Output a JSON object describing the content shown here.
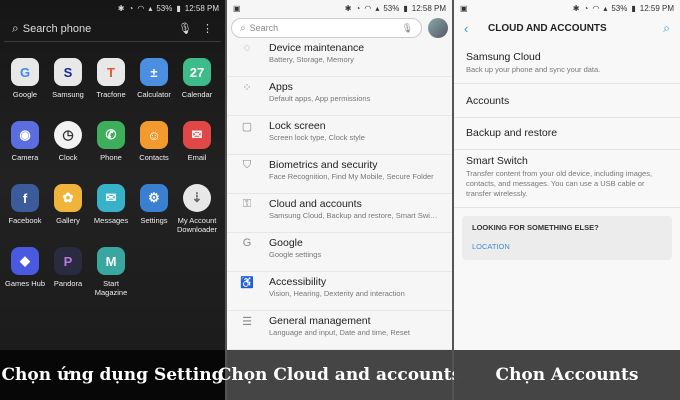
{
  "panel1": {
    "status": {
      "battery": "53%",
      "time": "12:58 PM"
    },
    "search_placeholder": "Search phone",
    "apps": [
      {
        "label": "Google",
        "icon": "google-folder-icon",
        "glyph": "G",
        "color": "#e8e8e8",
        "fg": "#4285f4"
      },
      {
        "label": "Samsung",
        "icon": "samsung-folder-icon",
        "glyph": "S",
        "color": "#e8e8e8",
        "fg": "#1428a0"
      },
      {
        "label": "Tracfone",
        "icon": "tracfone-folder-icon",
        "glyph": "T",
        "color": "#e8e8e8",
        "fg": "#e05a2a"
      },
      {
        "label": "Calculator",
        "icon": "calculator-icon",
        "glyph": "±",
        "color": "#4a8fe0",
        "fg": "#ffffff"
      },
      {
        "label": "Calendar",
        "icon": "calendar-icon",
        "glyph": "27",
        "color": "#3dbb8a",
        "fg": "#ffffff"
      },
      {
        "label": "Camera",
        "icon": "camera-icon",
        "glyph": "◉",
        "color": "#5b6ee0",
        "fg": "#ffffff"
      },
      {
        "label": "Clock",
        "icon": "clock-icon",
        "glyph": "◷",
        "color": "#f2f2f2",
        "fg": "#333333"
      },
      {
        "label": "Phone",
        "icon": "phone-icon",
        "glyph": "✆",
        "color": "#3fae5c",
        "fg": "#ffffff"
      },
      {
        "label": "Contacts",
        "icon": "contacts-icon",
        "glyph": "☺",
        "color": "#f29a2e",
        "fg": "#ffffff"
      },
      {
        "label": "Email",
        "icon": "email-icon",
        "glyph": "✉",
        "color": "#e04848",
        "fg": "#ffffff"
      },
      {
        "label": "Facebook",
        "icon": "facebook-icon",
        "glyph": "f",
        "color": "#3b5b9a",
        "fg": "#ffffff"
      },
      {
        "label": "Gallery",
        "icon": "gallery-icon",
        "glyph": "✿",
        "color": "#f0b43a",
        "fg": "#ffffff"
      },
      {
        "label": "Messages",
        "icon": "messages-icon",
        "glyph": "✉",
        "color": "#38b2c9",
        "fg": "#ffffff"
      },
      {
        "label": "Settings",
        "icon": "settings-icon",
        "glyph": "⚙",
        "color": "#3b7fd0",
        "fg": "#ffffff"
      },
      {
        "label": "My Account Downloader",
        "icon": "my-account-icon",
        "glyph": "⇣",
        "color": "#e8e8e8",
        "fg": "#666666"
      },
      {
        "label": "Games Hub",
        "icon": "games-hub-icon",
        "glyph": "◆",
        "color": "#4a5ae0",
        "fg": "#ffffff"
      },
      {
        "label": "Pandora",
        "icon": "pandora-icon",
        "glyph": "P",
        "color": "#2a2a40",
        "fg": "#b47bdc"
      },
      {
        "label": "Start Magazine",
        "icon": "start-magazine-icon",
        "glyph": "M",
        "color": "#3aa6a0",
        "fg": "#ffffff"
      }
    ],
    "caption": "Chọn ứng dụng Setting"
  },
  "panel2": {
    "status": {
      "battery": "53%",
      "time": "12:58 PM"
    },
    "search_placeholder": "Search",
    "items": [
      {
        "title": "Device maintenance",
        "sub": "Battery, Storage, Memory",
        "icon": "device-maintenance-icon",
        "glyph": "◌"
      },
      {
        "title": "Apps",
        "sub": "Default apps, App permissions",
        "icon": "apps-icon",
        "glyph": "⁘"
      },
      {
        "title": "Lock screen",
        "sub": "Screen lock type, Clock style",
        "icon": "lock-screen-icon",
        "glyph": "▢"
      },
      {
        "title": "Biometrics and security",
        "sub": "Face Recognition, Find My Mobile, Secure Folder",
        "icon": "shield-icon",
        "glyph": "⛉"
      },
      {
        "title": "Cloud and accounts",
        "sub": "Samsung Cloud, Backup and restore, Smart Swi…",
        "icon": "key-icon",
        "glyph": "⚿"
      },
      {
        "title": "Google",
        "sub": "Google settings",
        "icon": "google-icon",
        "glyph": "G"
      },
      {
        "title": "Accessibility",
        "sub": "Vision, Hearing, Dexterity and interaction",
        "icon": "accessibility-icon",
        "glyph": "♿"
      },
      {
        "title": "General management",
        "sub": "Language and input, Date and time, Reset",
        "icon": "sliders-icon",
        "glyph": "☰"
      }
    ],
    "caption": "Chọn Cloud and accounts"
  },
  "panel3": {
    "status": {
      "battery": "53%",
      "time": "12:59 PM"
    },
    "title": "CLOUD AND ACCOUNTS",
    "items": [
      {
        "title": "Samsung Cloud",
        "sub": "Back up your phone and sync your data."
      },
      {
        "title": "Accounts",
        "sub": ""
      },
      {
        "title": "Backup and restore",
        "sub": ""
      },
      {
        "title": "Smart Switch",
        "sub": "Transfer content from your old device, including images, contacts, and messages. You can use a USB cable or transfer wirelessly."
      }
    ],
    "looking_header": "LOOKING FOR SOMETHING ELSE?",
    "location_link": "LOCATION",
    "caption": "Chọn Accounts"
  }
}
